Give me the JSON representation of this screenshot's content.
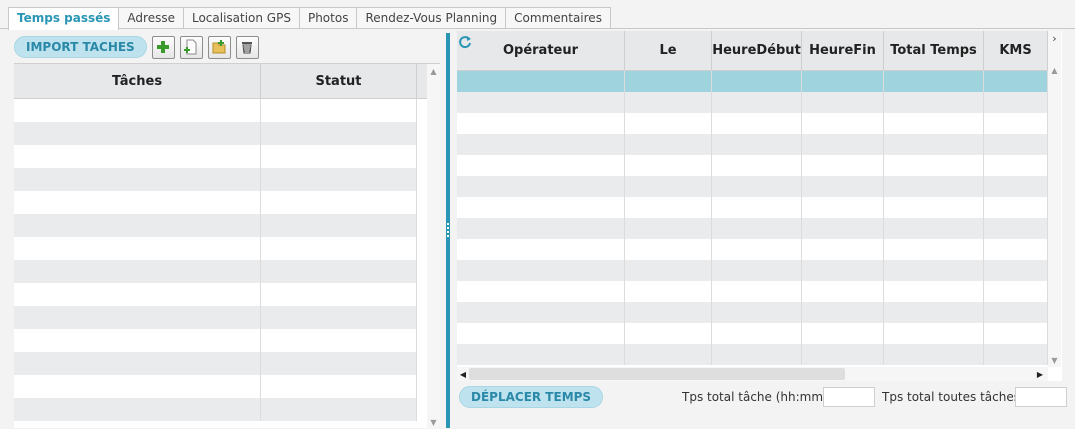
{
  "tabs": [
    {
      "label": "Temps passés",
      "active": true
    },
    {
      "label": "Adresse",
      "active": false
    },
    {
      "label": "Localisation GPS",
      "active": false
    },
    {
      "label": "Photos",
      "active": false
    },
    {
      "label": "Rendez-Vous Planning",
      "active": false
    },
    {
      "label": "Commentaires",
      "active": false
    }
  ],
  "left": {
    "import_label": "IMPORT TACHES",
    "toolbar_icons": [
      "add-icon",
      "add-document-icon",
      "add-folder-icon",
      "delete-icon"
    ],
    "columns": [
      "Tâches",
      "Statut"
    ],
    "rows": [
      [
        "",
        ""
      ],
      [
        "",
        ""
      ],
      [
        "",
        ""
      ],
      [
        "",
        ""
      ],
      [
        "",
        ""
      ],
      [
        "",
        ""
      ],
      [
        "",
        ""
      ],
      [
        "",
        ""
      ],
      [
        "",
        ""
      ],
      [
        "",
        ""
      ],
      [
        "",
        ""
      ],
      [
        "",
        ""
      ],
      [
        "",
        ""
      ],
      [
        "",
        ""
      ]
    ]
  },
  "right": {
    "columns": [
      "Opérateur",
      "Le",
      "HeureDébut",
      "HeureFin",
      "Total Temps",
      "KMS"
    ],
    "rows": [
      [
        "",
        "",
        "",
        "",
        "",
        ""
      ],
      [
        "",
        "",
        "",
        "",
        "",
        ""
      ],
      [
        "",
        "",
        "",
        "",
        "",
        ""
      ],
      [
        "",
        "",
        "",
        "",
        "",
        ""
      ],
      [
        "",
        "",
        "",
        "",
        "",
        ""
      ],
      [
        "",
        "",
        "",
        "",
        "",
        ""
      ],
      [
        "",
        "",
        "",
        "",
        "",
        ""
      ],
      [
        "",
        "",
        "",
        "",
        "",
        ""
      ],
      [
        "",
        "",
        "",
        "",
        "",
        ""
      ],
      [
        "",
        "",
        "",
        "",
        "",
        ""
      ],
      [
        "",
        "",
        "",
        "",
        "",
        ""
      ],
      [
        "",
        "",
        "",
        "",
        "",
        ""
      ],
      [
        "",
        "",
        "",
        "",
        "",
        ""
      ],
      [
        "",
        "",
        "",
        "",
        "",
        ""
      ]
    ],
    "selected_row": 0,
    "move_label": "DÉPLACER TEMPS",
    "total_task_label": "Tps total tâche (hh:mm)",
    "total_task_value": "",
    "total_all_label": "Tps total toutes tâches",
    "total_all_value": ""
  },
  "colors": {
    "accent": "#2a96b5",
    "selected_row": "#9fd4df",
    "pill_bg": "#bfe3ee"
  }
}
